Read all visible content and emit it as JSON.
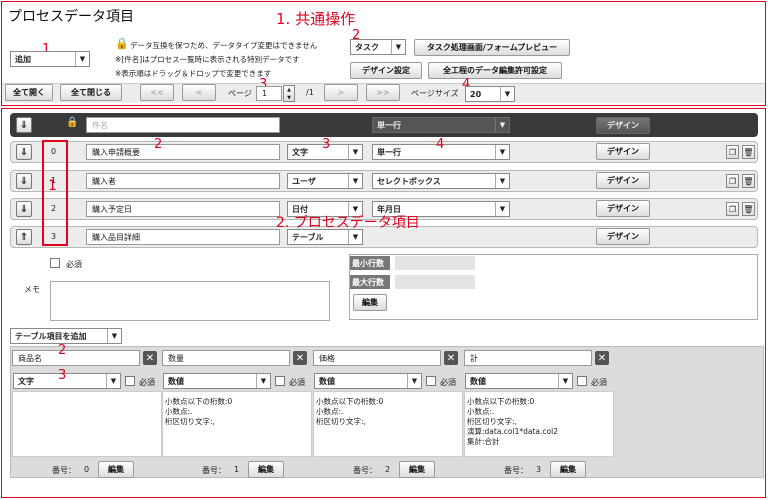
{
  "title": "プロセスデータ項目",
  "annotations": {
    "sec1": "1. 共通操作",
    "sec2": "2. プロセスデータ項目",
    "n1": "1",
    "n2": "2",
    "n3": "3",
    "n4": "4"
  },
  "top": {
    "add_select": "追加",
    "lock_note": "データ互換を保つため、データタイプ変更はできません",
    "note2": "※[件名]はプロセス一覧時に表示される特別データです",
    "note3": "※表示順はドラッグ＆ドロップで変更できます",
    "task_select": "タスク",
    "task_preview": "タスク処理画面/フォームプレビュー",
    "design_settings": "デザイン設定",
    "edit_permission": "全工程のデータ編集許可設定"
  },
  "pager": {
    "expand_all": "全て開く",
    "collapse_all": "全て閉じる",
    "first": "<<",
    "prev": "<",
    "page_label": "ページ",
    "page": "1",
    "total": "/1",
    "next": ">",
    "last": ">>",
    "size_label": "ページサイズ",
    "size": "20"
  },
  "header_row": {
    "name": "件名",
    "type": "単一行",
    "design": "デザイン"
  },
  "rows": [
    {
      "num": "0",
      "name": "購入申請概要",
      "dtype": "文字",
      "format": "単一行",
      "design": "デザイン",
      "arrow": "⇓"
    },
    {
      "num": "1",
      "name": "購入者",
      "dtype": "ユーザ",
      "format": "セレクトボックス",
      "design": "デザイン",
      "arrow": "⇓"
    },
    {
      "num": "2",
      "name": "購入予定日",
      "dtype": "日付",
      "format": "年月日",
      "design": "デザイン",
      "arrow": "⇓"
    },
    {
      "num": "3",
      "name": "購入品目詳細",
      "dtype": "テーブル",
      "format": "",
      "design": "デザイン",
      "arrow": "⇑"
    }
  ],
  "detail": {
    "required": "必須",
    "memo": "メモ",
    "min_rows": "最小行数",
    "max_rows": "最大行数",
    "edit": "編集",
    "add_table_item": "テーブル項目を追加"
  },
  "columns": [
    {
      "name": "商品名",
      "dtype": "文字",
      "required": "必須",
      "info": [],
      "num_label": "番号：",
      "num": "0",
      "edit": "編集"
    },
    {
      "name": "数量",
      "dtype": "数値",
      "required": "必須",
      "info": [
        "小数点以下の桁数:0",
        "小数点:.",
        "桁区切り文字:,"
      ],
      "num_label": "番号：",
      "num": "1",
      "edit": "編集"
    },
    {
      "name": "価格",
      "dtype": "数値",
      "required": "必須",
      "info": [
        "小数点以下の桁数:0",
        "小数点:.",
        "桁区切り文字:,"
      ],
      "num_label": "番号：",
      "num": "2",
      "edit": "編集"
    },
    {
      "name": "計",
      "dtype": "数値",
      "required": "必須",
      "info": [
        "小数点以下の桁数:0",
        "小数点:.",
        "桁区切り文字:,",
        "演算:data.col1*data.col2",
        "集計:合計"
      ],
      "num_label": "番号：",
      "num": "3",
      "edit": "編集"
    }
  ],
  "colors": {
    "red": "#e00020",
    "dark_row": "#3a3a3a",
    "panel": "#ececec"
  }
}
